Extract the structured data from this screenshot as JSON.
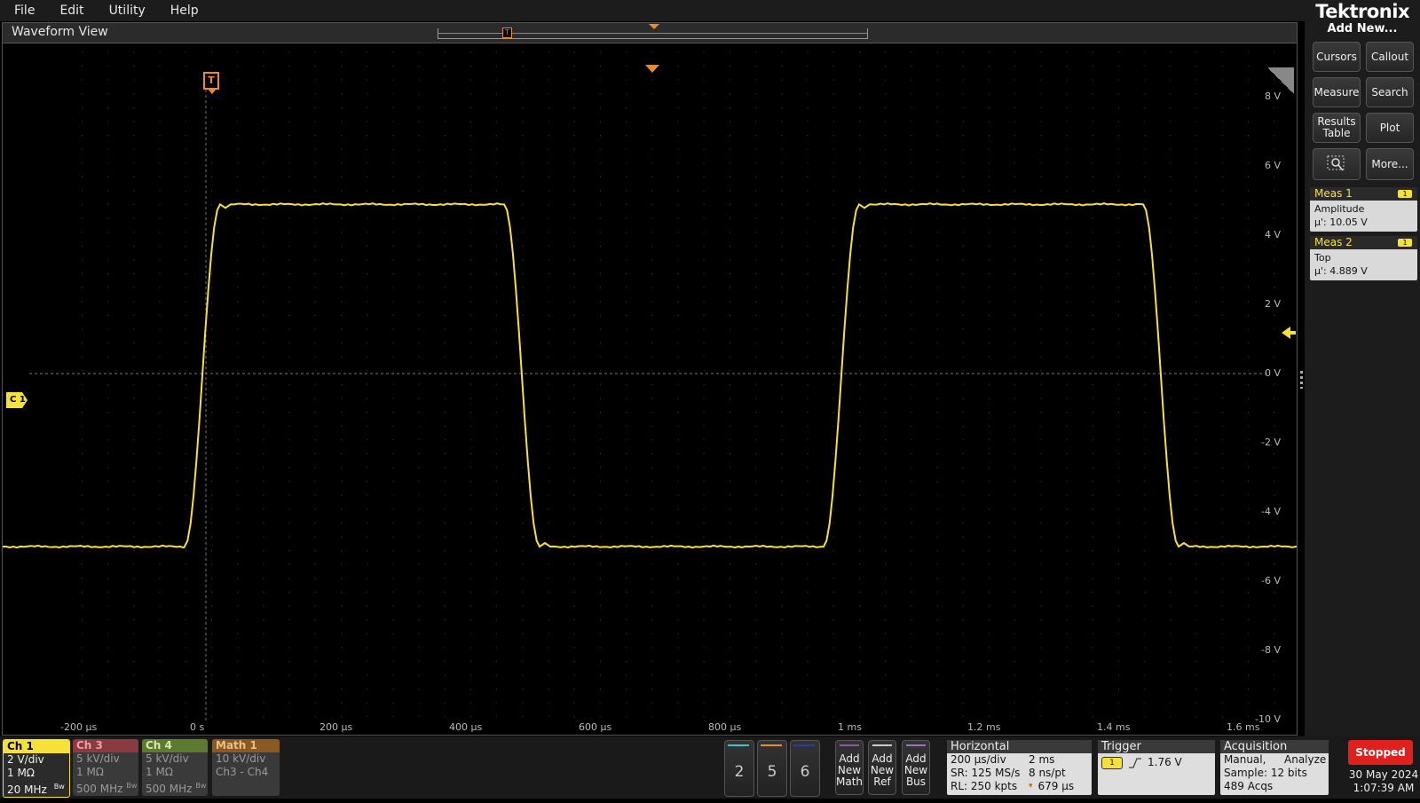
{
  "menu": [
    "File",
    "Edit",
    "Utility",
    "Help"
  ],
  "brand": "Tektronix",
  "waveform_view": {
    "title": "Waveform View",
    "trigger_marker": "T",
    "channel_marker": "C 1",
    "y_labels": [
      "8 V",
      "6 V",
      "4 V",
      "2 V",
      "0 V",
      "-2 V",
      "-4 V",
      "-6 V",
      "-8 V",
      "-10 V"
    ],
    "x_labels": [
      "-200 µs",
      "0 s",
      "200 µs",
      "400 µs",
      "600 µs",
      "800 µs",
      "1 ms",
      "1.2 ms",
      "1.4 ms",
      "1.6 ms"
    ],
    "trace_color": "#f5e13a"
  },
  "sidebar": {
    "add_new": "Add New...",
    "buttons": [
      "Cursors",
      "Callout",
      "Measure",
      "Search",
      "Results Table",
      "Plot",
      "",
      "More..."
    ],
    "measurements": [
      {
        "title": "Meas 1",
        "badge": "1",
        "name": "Amplitude",
        "value": "µ': 10.05 V"
      },
      {
        "title": "Meas 2",
        "badge": "1",
        "name": "Top",
        "value": "µ': 4.889 V"
      }
    ]
  },
  "channels": [
    {
      "label": "Ch 1",
      "lines": [
        "2 V/div",
        "1 MΩ",
        "20 MHz"
      ],
      "bw": "Bw",
      "color": "#f5e13a"
    },
    {
      "label": "Ch 3",
      "lines": [
        "5 kV/div",
        "1 MΩ",
        "500 MHz"
      ],
      "bw": "Bw",
      "color": "#c0404a"
    },
    {
      "label": "Ch 4",
      "lines": [
        "5 kV/div",
        "1 MΩ",
        "500 MHz"
      ],
      "bw": "Bw",
      "color": "#7aa83a"
    },
    {
      "label": "Math 1",
      "lines": [
        "10 kV/div",
        "Ch3 - Ch4"
      ],
      "color": "#e08a2a"
    }
  ],
  "channel_buttons": [
    "2",
    "5",
    "6"
  ],
  "add_buttons": [
    {
      "lines": [
        "Add",
        "New",
        "Math"
      ]
    },
    {
      "lines": [
        "Add",
        "New",
        "Ref"
      ]
    },
    {
      "lines": [
        "Add",
        "New",
        "Bus"
      ]
    }
  ],
  "horizontal": {
    "title": "Horizontal",
    "scale": "200 µs/div",
    "duration": "2 ms",
    "sample_rate": "SR: 125 MS/s",
    "per_point": "8 ns/pt",
    "record_length": "RL: 250 kpts",
    "position": "679 µs"
  },
  "trigger": {
    "title": "Trigger",
    "source": "1",
    "level": "1.76 V"
  },
  "acquisition": {
    "title": "Acquisition",
    "mode": "Manual,",
    "analyze": "Analyze",
    "sample": "Sample: 12 bits",
    "acqs": "489 Acqs"
  },
  "status": {
    "state": "Stopped",
    "date": "30 May 2024",
    "time": "1:07:39 AM"
  }
}
